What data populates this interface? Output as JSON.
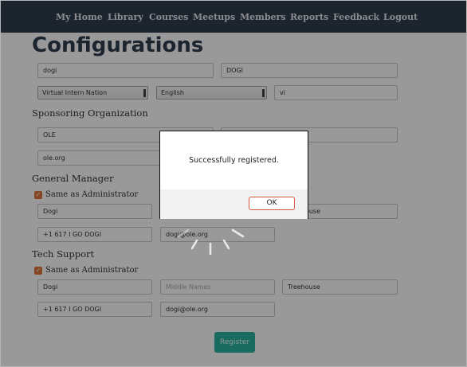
{
  "nav": {
    "items": [
      "My Home",
      "Library",
      "Courses",
      "Meetups",
      "Members",
      "Reports",
      "Feedback",
      "Logout"
    ]
  },
  "page": {
    "title": "Configurations"
  },
  "config": {
    "name": "dogi",
    "code": "DOGI",
    "nation": "Virtual Intern Nation",
    "language": "English",
    "language_code": "vi"
  },
  "sponsor": {
    "heading": "Sponsoring Organization",
    "name": "OLE",
    "url": "ole.org"
  },
  "general_manager": {
    "heading": "General Manager",
    "same_as_admin": "Same as Administrator",
    "first_name": "Dogi",
    "last_name": "house",
    "phone": "+1 617 I GO DOGI",
    "email": "dogi@ole.org"
  },
  "tech_support": {
    "heading": "Tech Support",
    "same_as_admin": "Same as Administrator",
    "first_name": "Dogi",
    "middle_placeholder": "Middle Names",
    "last_name": "Treehouse",
    "phone": "+1 617 I GO DOGI",
    "email": "dogi@ole.org"
  },
  "register_label": "Register",
  "dialog": {
    "message": "Successfully registered.",
    "ok_label": "OK"
  },
  "colors": {
    "nav_bg": "#2f3d4e",
    "accent": "#2ab3a0",
    "checkbox": "#e0763a"
  }
}
